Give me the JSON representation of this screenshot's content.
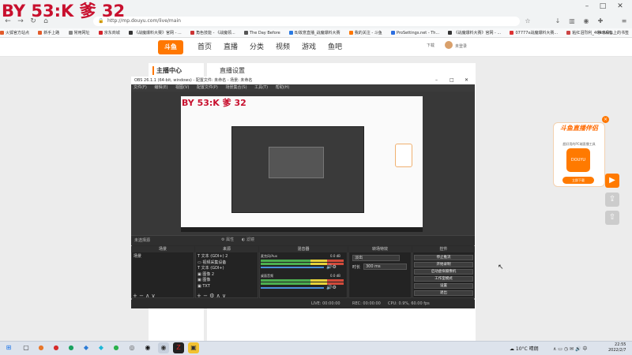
{
  "watermark": "BY 53:K 爹 32",
  "browser": {
    "url": "http://mp.douyu.com/live/main",
    "window_controls": [
      "–",
      "□",
      "✕"
    ],
    "bookmarks": [
      "火狐官方站点",
      "新手上路",
      "常用网址",
      "京东商城",
      "《战魔爆料大赛》官网 - ...",
      "角色技能 - 《战魔领...",
      "The Day Before",
      "B/故意直播_战魔爆料大赛",
      "我的关注 - 斗鱼",
      "ProSettings.net - Th...",
      "《战魔爆料大赛》官网 - ...",
      "07777x战魔爆料大赛...",
      "粘红泪烈利_404 RAP..."
    ],
    "mobile_bookmarks": "移动设备上的书签"
  },
  "douyu": {
    "logo": "斗鱼",
    "nav": [
      "首页",
      "直播",
      "分类",
      "视频",
      "游戏",
      "鱼吧"
    ],
    "download": "下载",
    "username": "未登录",
    "sidebar_title": "主播中心",
    "content_title": "直播设置",
    "promo": {
      "title": "斗鱼直播伴侣",
      "subtitle": "超好用的PC端直播工具",
      "app": "DOUYU",
      "button": "立即下载"
    }
  },
  "obs": {
    "title": "OBS 26.1.1 (64-bit, windows) - 配置文件: 未命名 - 场景: 未命名",
    "menus": [
      "文件(F)",
      "编辑(E)",
      "视图(V)",
      "配置文件(P)",
      "场景集合(S)",
      "工具(T)",
      "帮助(H)"
    ],
    "no_source": "未选择源",
    "properties": "属性",
    "filters": "滤镜",
    "docks": {
      "scenes": {
        "title": "场景",
        "items": [
          "场景"
        ]
      },
      "sources": {
        "title": "来源",
        "items": [
          "文本 (GDI+) 2",
          "视频采集设备",
          "文本 (GDI+)",
          "图像 2",
          "图像",
          "TXT"
        ]
      },
      "mixer": {
        "title": "混音器",
        "channels": [
          {
            "name": "麦克风/Aux",
            "db": "0.0 dB"
          },
          {
            "name": "桌面音频",
            "db": "0.0 dB"
          }
        ]
      },
      "transitions": {
        "title": "转场特效",
        "type": "淡出",
        "duration_label": "时长",
        "duration": "300 ms"
      },
      "controls": {
        "title": "控件",
        "buttons": [
          "停止推流",
          "开始录制",
          "启动虚拟摄像机",
          "工作室模式",
          "设置",
          "退出"
        ]
      }
    },
    "status": {
      "live": "LIVE: 00:00:00",
      "rec": "REC: 00:00:00",
      "cpu": "CPU: 0.9%, 60.00 fps"
    }
  },
  "taskbar": {
    "weather": "10°C 晴朗",
    "time": "22:55",
    "date": "2022/2/7"
  }
}
